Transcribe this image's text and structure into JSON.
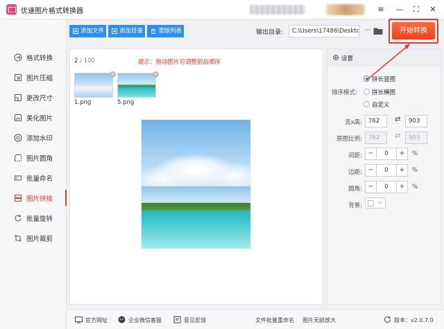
{
  "window": {
    "title": "优速图片格式转换器",
    "controls": [
      "≡",
      "—",
      "⛶",
      "✕"
    ]
  },
  "sidebar": {
    "items": [
      {
        "label": "格式转换",
        "icon": "format-convert-icon",
        "active": false
      },
      {
        "label": "图片压缩",
        "icon": "compress-icon",
        "active": false
      },
      {
        "label": "更改尺寸",
        "icon": "resize-icon",
        "active": false
      },
      {
        "label": "美化图片",
        "icon": "beautify-icon",
        "active": false
      },
      {
        "label": "添加水印",
        "icon": "watermark-icon",
        "active": false
      },
      {
        "label": "图片圆角",
        "icon": "rounded-corner-icon",
        "active": false
      },
      {
        "label": "批量命名",
        "icon": "rename-icon",
        "active": false
      },
      {
        "label": "图片拼接",
        "icon": "stitch-icon",
        "active": true
      },
      {
        "label": "批量旋转",
        "icon": "rotate-icon",
        "active": false
      },
      {
        "label": "图片裁剪",
        "icon": "crop-icon",
        "active": false
      }
    ]
  },
  "toolbar": {
    "add_file": "添加文件",
    "add_folder": "添加目录",
    "clear_list": "清除列表",
    "output_label": "输出目录:",
    "output_path": "C:\\Users\\17486\\Deskto",
    "more": "···",
    "start": "开始转换"
  },
  "files": {
    "count": "2",
    "total": "/ 100",
    "hint": "提示：拖动图片可调整前后顺序",
    "items": [
      {
        "name": "1.png",
        "close": "×"
      },
      {
        "name": "5.png",
        "close": "×"
      }
    ]
  },
  "settings": {
    "title": "设置",
    "sort_label": "排序模式:",
    "sort_options": [
      {
        "label": "拼长竖图",
        "selected": true
      },
      {
        "label": "拼长横图",
        "selected": false
      },
      {
        "label": "自定义",
        "selected": false
      }
    ],
    "size_label": "宽x高:",
    "width": "762",
    "height": "903",
    "ratio_label": "原图比例:",
    "ratio_w": "762",
    "ratio_h": "903",
    "spacing_label": "间距:",
    "spacing": "0",
    "border_label": "边距:",
    "border": "0",
    "radius_label": "圆角:",
    "radius": "0",
    "bg_label": "背景:",
    "percent": "%",
    "minus": "−",
    "plus": "+",
    "swap": "⇄"
  },
  "statusbar": {
    "website": "官方网址",
    "wechat": "企业微信客服",
    "feedback": "意见反馈",
    "batch_rename": "文件批量重命名",
    "lossless": "图片无损放大",
    "version": "版本：v2.0.7.0"
  },
  "colors": {
    "accent": "#2c8ef0",
    "highlight": "#e53b2c",
    "start_button": "#f0401c"
  }
}
